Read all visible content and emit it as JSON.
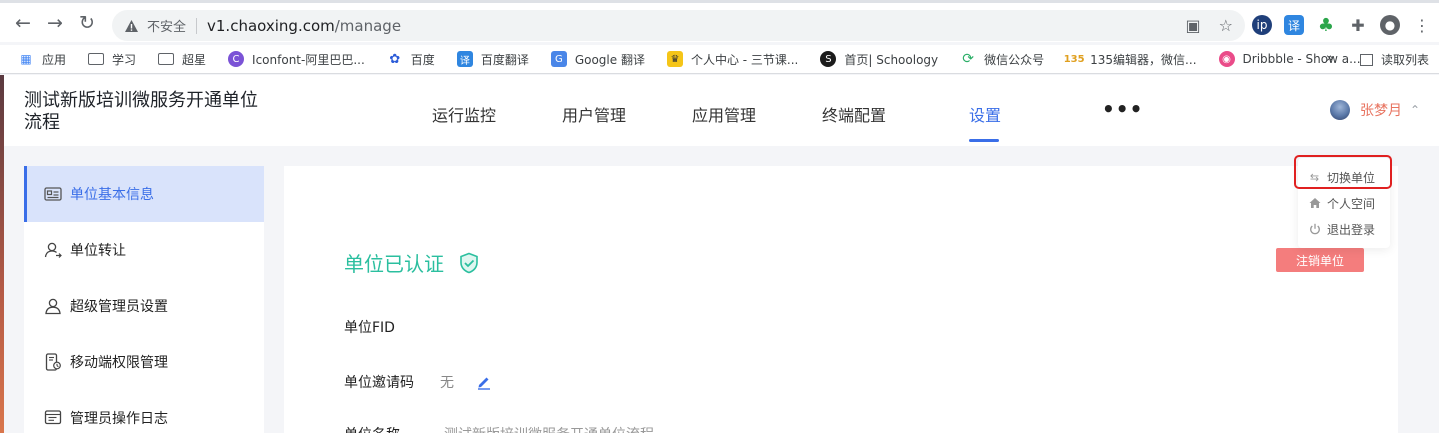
{
  "browser": {
    "insecure_label": "不安全",
    "url_host": "v1.chaoxing.com",
    "url_path": "/manage",
    "bookmarks": [
      {
        "label": "应用",
        "icon": "apps-grid-icon"
      },
      {
        "label": "学习",
        "icon": "folder-icon"
      },
      {
        "label": "超星",
        "icon": "folder-icon"
      },
      {
        "label": "Iconfont-阿里巴巴...",
        "icon": "iconfont-icon"
      },
      {
        "label": "百度",
        "icon": "baidu-paw-icon"
      },
      {
        "label": "百度翻译",
        "icon": "baidu-translate-icon"
      },
      {
        "label": "Google 翻译",
        "icon": "google-translate-icon"
      },
      {
        "label": "个人中心 - 三节课...",
        "icon": "crown-icon"
      },
      {
        "label": "首页| Schoology",
        "icon": "schoology-icon"
      },
      {
        "label": "微信公众号",
        "icon": "wechat-icon"
      },
      {
        "label": "135编辑器，微信...",
        "icon": "editor-135-icon"
      },
      {
        "label": "Dribbble - Show a...",
        "icon": "dribbble-icon"
      }
    ],
    "more_chevron": "»",
    "reading_list": "读取列表"
  },
  "app": {
    "title": "测试新版培训微服务开通单位流程",
    "nav": [
      "运行监控",
      "用户管理",
      "应用管理",
      "终端配置",
      "设置"
    ],
    "active_nav": "设置",
    "more": "•••",
    "user_name": "张梦月"
  },
  "sidebar": {
    "items": [
      {
        "label": "单位基本信息",
        "icon": "id-card-icon",
        "active": true
      },
      {
        "label": "单位转让",
        "icon": "user-transfer-icon",
        "active": false
      },
      {
        "label": "超级管理员设置",
        "icon": "admin-user-icon",
        "active": false
      },
      {
        "label": "移动端权限管理",
        "icon": "mobile-permission-icon",
        "active": false
      },
      {
        "label": "管理员操作日志",
        "icon": "log-icon",
        "active": false
      }
    ]
  },
  "main": {
    "verified_title": "单位已认证",
    "cancel_button": "注销单位",
    "fields": [
      {
        "label": "单位FID",
        "value": ""
      },
      {
        "label": "单位邀请码",
        "value": "无"
      },
      {
        "label": "单位名称",
        "value": "测试新版培训微服务开通单位流程"
      }
    ]
  },
  "dropdown": {
    "items": [
      {
        "label": "切换单位",
        "icon": "switch-arrows-icon"
      },
      {
        "label": "个人空间",
        "icon": "home-icon"
      },
      {
        "label": "退出登录",
        "icon": "power-icon"
      }
    ]
  },
  "colors": {
    "accent": "#3a6ee8",
    "verified": "#2bbf9f",
    "danger": "#f47d7d",
    "user_name": "#e8735f",
    "highlight": "#e02020"
  }
}
